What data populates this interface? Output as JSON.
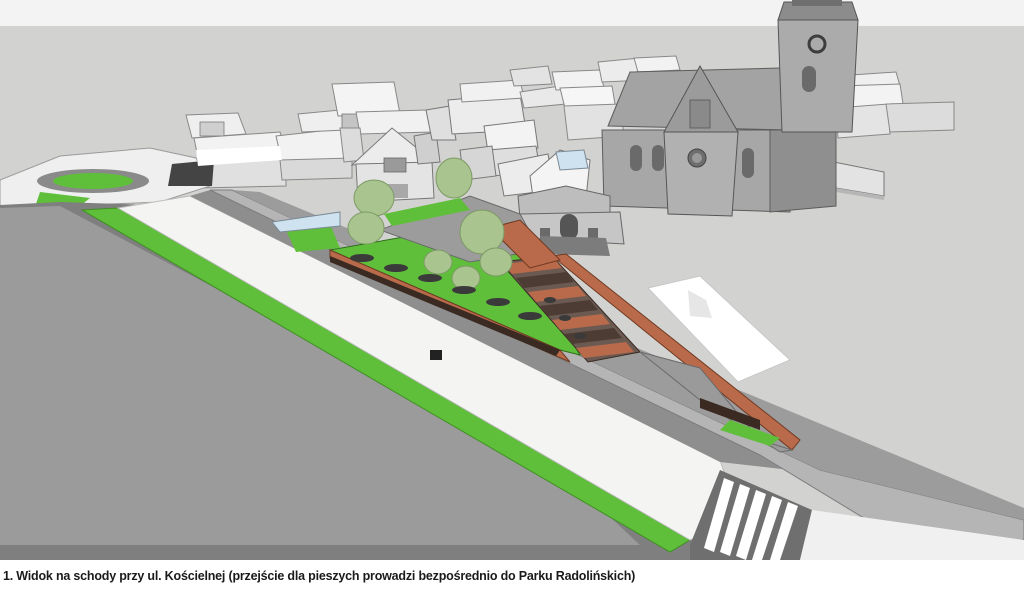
{
  "caption": "1. Widok na schody przy ul. Kościelnej (przejście dla pieszych prowadzi bezpośrednio do Parku Radolińskich)",
  "colors": {
    "sky": "#f3f3f3",
    "ground": "#d2d2d0",
    "building": "#e8e8e8",
    "building_shadow": "#a9a9a9",
    "church": "#9c9c9c",
    "church_dark": "#7d7d7d",
    "grass": "#5fbf3a",
    "road": "#8e8e8e",
    "road_edge": "#6f6f6f",
    "pavement": "#f4f4f2",
    "brick": "#b96a4a",
    "stair_dark": "#4d3c34",
    "tree": "#a9c48f"
  },
  "scene_elements": [
    "church",
    "bell-tower",
    "town-buildings",
    "roundabout",
    "street",
    "sidewalk",
    "grass-strip",
    "staircase",
    "terrace-planter",
    "trees",
    "crosswalk",
    "white-plot"
  ]
}
